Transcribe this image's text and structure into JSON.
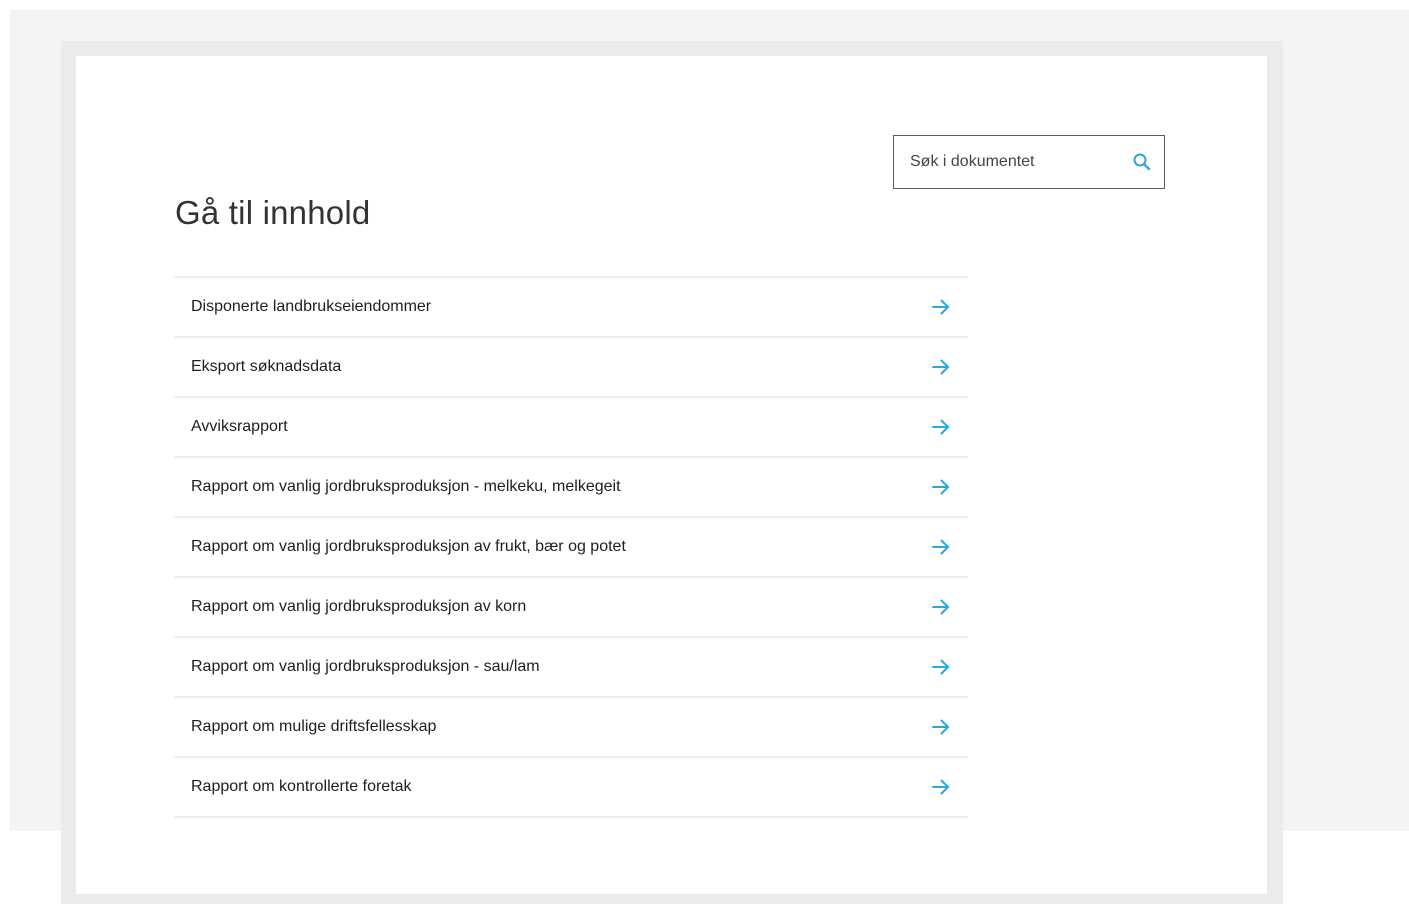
{
  "search": {
    "placeholder": "Søk i dokumentet",
    "icon": "search-icon"
  },
  "page": {
    "title": "Gå til innhold"
  },
  "toc": {
    "arrow_icon": "arrow-right-icon",
    "accent_color": "#2aa8d8",
    "items": [
      {
        "label": "Disponerte landbrukseiendommer"
      },
      {
        "label": "Eksport søknadsdata"
      },
      {
        "label": "Avviksrapport"
      },
      {
        "label": "Rapport om vanlig jordbruksproduksjon - melkeku, melkegeit"
      },
      {
        "label": "Rapport om vanlig jordbruksproduksjon av frukt, bær og potet"
      },
      {
        "label": "Rapport om vanlig jordbruksproduksjon av korn"
      },
      {
        "label": "Rapport om vanlig jordbruksproduksjon - sau/lam"
      },
      {
        "label": "Rapport om mulige driftsfellesskap"
      },
      {
        "label": "Rapport om kontrollerte foretak"
      }
    ]
  }
}
